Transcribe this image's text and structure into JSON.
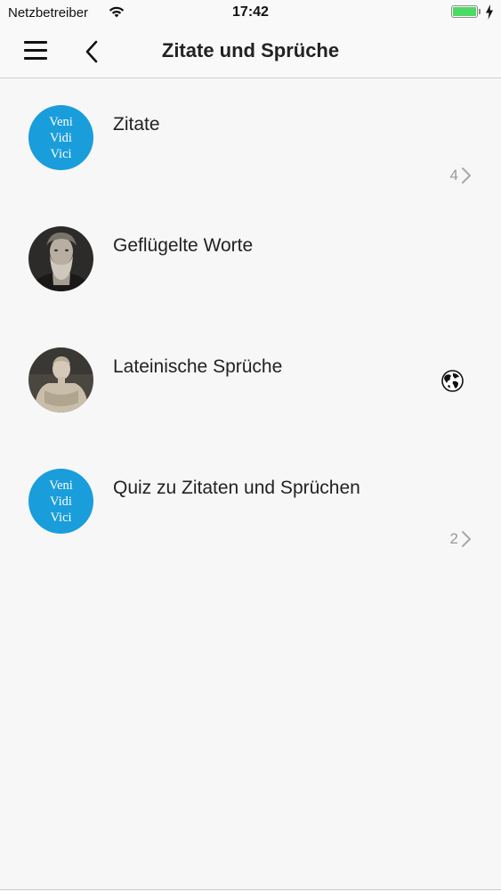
{
  "status_bar": {
    "carrier": "Netzbetreiber",
    "time": "17:42",
    "battery_level": 1.0,
    "battery_color": "#4cd964"
  },
  "nav": {
    "title": "Zitate und Sprüche",
    "menu_icon": "hamburger-menu-icon",
    "back_icon": "chevron-left-icon"
  },
  "list": {
    "items": [
      {
        "title": "Zitate",
        "avatar": "veni-vidi-vici-logo",
        "avatar_lines": [
          "Veni",
          "Vidi",
          "Vici"
        ],
        "count": "4",
        "accessory": "chevron-right-icon"
      },
      {
        "title": "Geflügelte Worte",
        "avatar": "bearded-man-portrait"
      },
      {
        "title": "Lateinische Sprüche",
        "avatar": "augustus-statue-photo",
        "accessory": "globe-icon"
      },
      {
        "title": "Quiz zu Zitaten und Sprüchen",
        "avatar": "veni-vidi-vici-logo",
        "avatar_lines": [
          "Veni",
          "Vidi",
          "Vici"
        ],
        "count": "2",
        "accessory": "chevron-right-icon"
      }
    ]
  },
  "colors": {
    "accent_blue": "#1a9ddb",
    "background": "#f7f7f7",
    "secondary_text": "#999999"
  }
}
